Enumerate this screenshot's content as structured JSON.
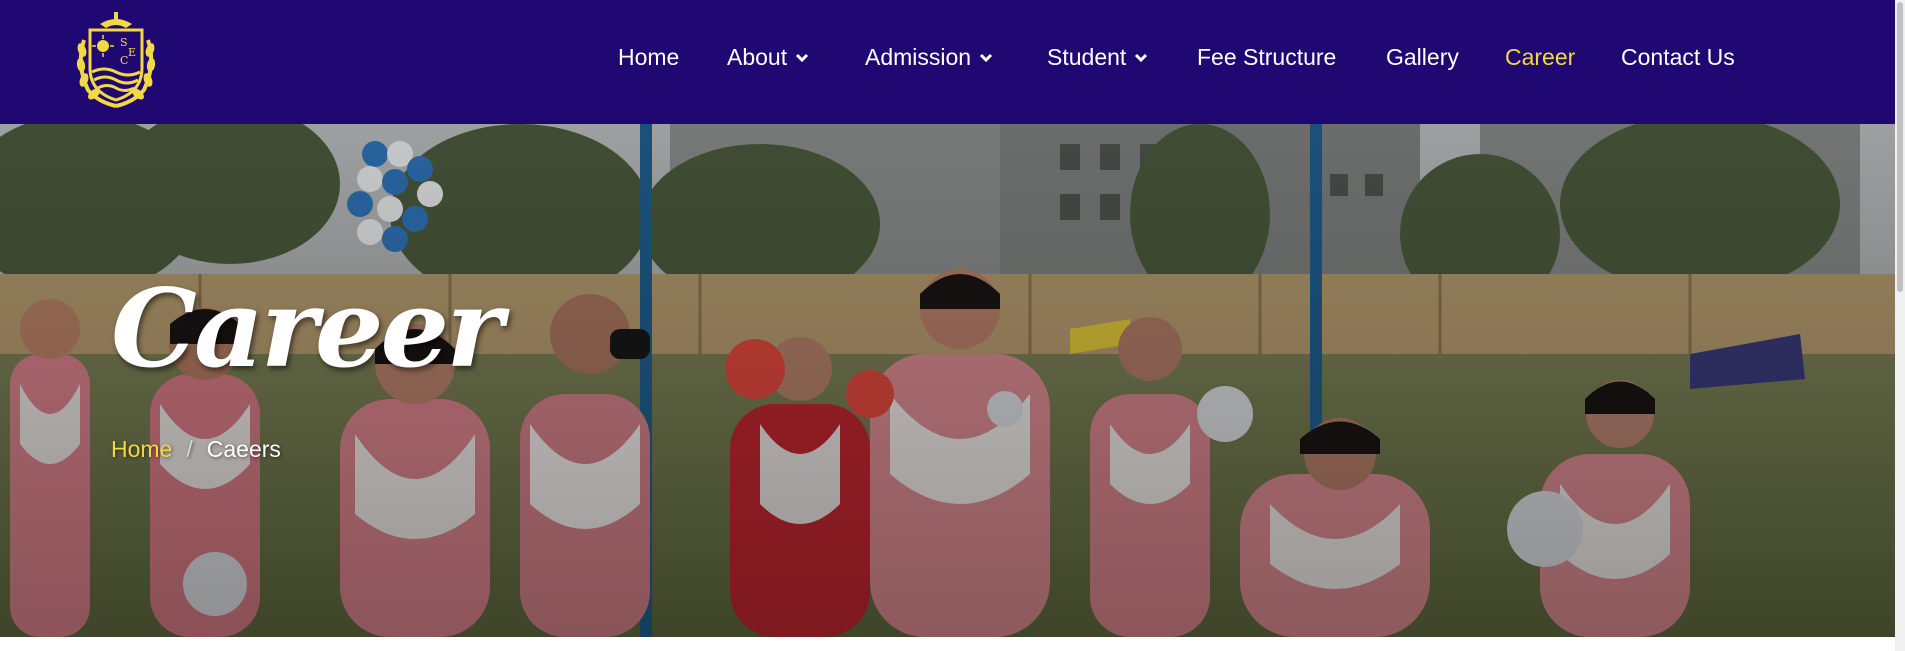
{
  "nav": {
    "items": [
      {
        "label": "Home",
        "dropdown": false,
        "active": false
      },
      {
        "label": "About",
        "dropdown": true,
        "active": false
      },
      {
        "label": "Admission",
        "dropdown": true,
        "active": false
      },
      {
        "label": "Student",
        "dropdown": true,
        "active": false
      },
      {
        "label": "Fee Structure",
        "dropdown": false,
        "active": false
      },
      {
        "label": "Gallery",
        "dropdown": false,
        "active": false
      },
      {
        "label": "Career",
        "dropdown": false,
        "active": true
      },
      {
        "label": "Contact Us",
        "dropdown": false,
        "active": false
      }
    ]
  },
  "logo": {
    "icon": "school-crest-icon",
    "letters": "SEC"
  },
  "hero": {
    "title": "Career",
    "breadcrumb": {
      "home": "Home",
      "separator": "/",
      "current": "Caeers"
    }
  },
  "colors": {
    "navbar_bg": "#200872",
    "accent_yellow": "#f2d843",
    "text_white": "#ffffff"
  }
}
